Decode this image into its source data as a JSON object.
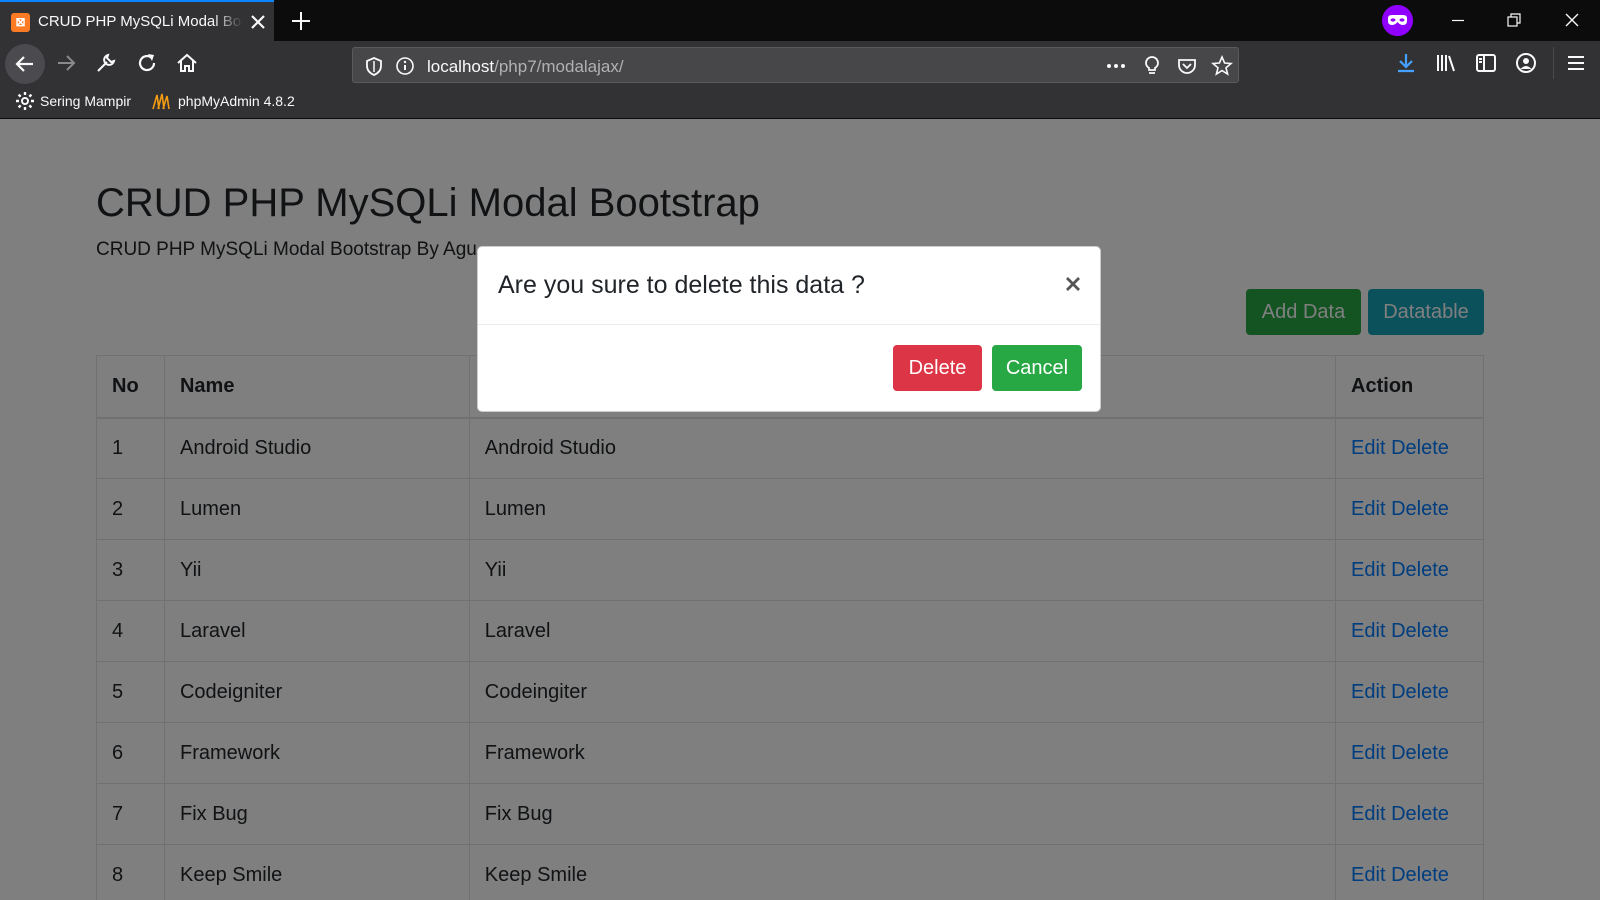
{
  "browser": {
    "tab_title": "CRUD PHP MySQLi Modal Bootstrap",
    "favicon_text": "⊠",
    "url_host": "localhost",
    "url_path": "/php7/modalajax/",
    "bookmarks": [
      {
        "label": "Sering Mampir",
        "icon": "gear-icon"
      },
      {
        "label": "phpMyAdmin 4.8.2",
        "icon": "phpmyadmin-icon"
      }
    ]
  },
  "page": {
    "title": "CRUD PHP MySQLi Modal Bootstrap",
    "subtitle": "CRUD PHP MySQLi Modal Bootstrap By Agu",
    "add_button": "Add Data",
    "datatable_button": "Datatable"
  },
  "table": {
    "headers": [
      "No",
      "Name",
      "",
      "Action"
    ],
    "rows": [
      {
        "no": "1",
        "name": "Android Studio",
        "desc": "Android Studio",
        "edit": "Edit",
        "delete": "Delete"
      },
      {
        "no": "2",
        "name": "Lumen",
        "desc": "Lumen",
        "edit": "Edit",
        "delete": "Delete"
      },
      {
        "no": "3",
        "name": "Yii",
        "desc": "Yii",
        "edit": "Edit",
        "delete": "Delete"
      },
      {
        "no": "4",
        "name": "Laravel",
        "desc": "Laravel",
        "edit": "Edit",
        "delete": "Delete"
      },
      {
        "no": "5",
        "name": "Codeigniter",
        "desc": "Codeingiter",
        "edit": "Edit",
        "delete": "Delete"
      },
      {
        "no": "6",
        "name": "Framework",
        "desc": "Framework",
        "edit": "Edit",
        "delete": "Delete"
      },
      {
        "no": "7",
        "name": "Fix Bug",
        "desc": "Fix Bug",
        "edit": "Edit",
        "delete": "Delete"
      },
      {
        "no": "8",
        "name": "Keep Smile",
        "desc": "Keep Smile",
        "edit": "Edit",
        "delete": "Delete"
      }
    ]
  },
  "modal": {
    "title": "Are you sure to delete this data ?",
    "close_glyph": "×",
    "delete_label": "Delete",
    "cancel_label": "Cancel"
  },
  "colors": {
    "accent_tab": "#0a84ff",
    "btn_success": "#28a745",
    "btn_info": "#17a2b8",
    "btn_danger": "#dc3545",
    "link": "#007bff",
    "private_badge": "#8f00ff"
  }
}
